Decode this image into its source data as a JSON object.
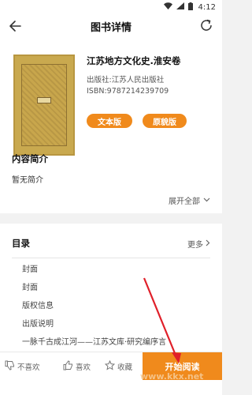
{
  "status_bar": {
    "time": "4:12"
  },
  "header": {
    "title": "图书详情"
  },
  "book": {
    "title": "江苏地方文化史.淮安卷",
    "publisher": "出版社:江苏人民出版社",
    "isbn": "ISBN:9787214239709",
    "btn_text_version": "文本版",
    "btn_original_version": "原貌版"
  },
  "intro": {
    "heading": "内容简介",
    "body": "暂无简介",
    "expand_label": "展开全部"
  },
  "toc": {
    "heading": "目录",
    "more_label": "更多",
    "items": [
      "封面",
      "封面",
      "版权信息",
      "出版说明",
      "一脉千古成江河——江苏文库·研究编序言"
    ]
  },
  "actions": {
    "dislike": "不喜欢",
    "like": "喜欢",
    "favorite": "收藏",
    "start_reading": "开始阅读"
  },
  "watermark": "www.kkx.net",
  "colors": {
    "accent": "#f08a1c",
    "arrow": "#e0202a"
  }
}
